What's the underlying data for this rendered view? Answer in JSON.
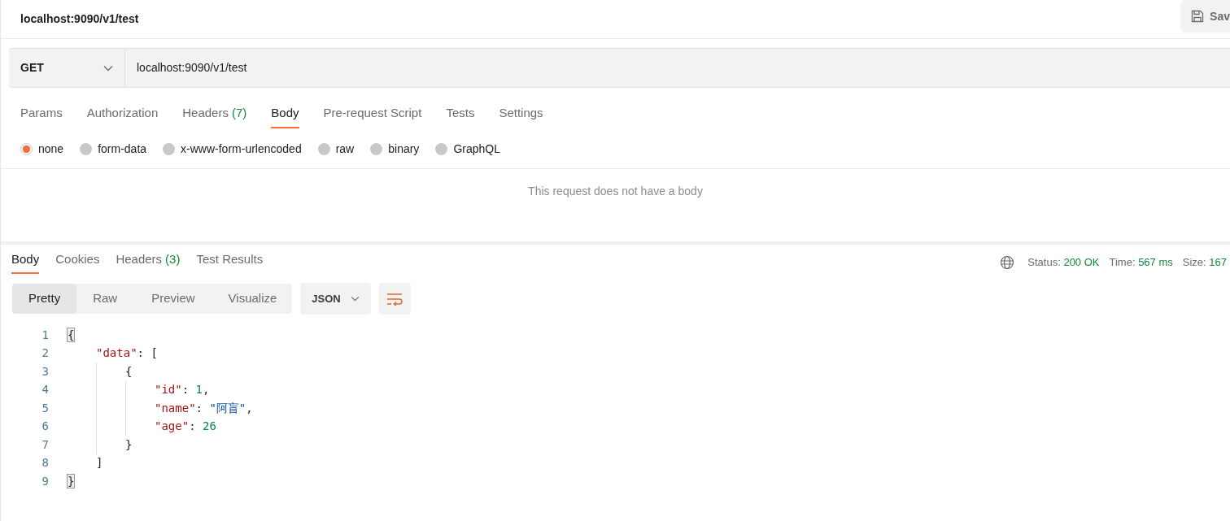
{
  "request_title": "localhost:9090/v1/test",
  "save_button": {
    "label": "Sav"
  },
  "method": "GET",
  "url": "localhost:9090/v1/test",
  "request_tabs": [
    {
      "label": "Params",
      "selected": false
    },
    {
      "label": "Authorization",
      "selected": false
    },
    {
      "label": "Headers",
      "count": "(7)",
      "selected": false
    },
    {
      "label": "Body",
      "selected": true
    },
    {
      "label": "Pre-request Script",
      "selected": false
    },
    {
      "label": "Tests",
      "selected": false
    },
    {
      "label": "Settings",
      "selected": false
    }
  ],
  "body_types": [
    {
      "label": "none",
      "selected": true
    },
    {
      "label": "form-data",
      "selected": false
    },
    {
      "label": "x-www-form-urlencoded",
      "selected": false
    },
    {
      "label": "raw",
      "selected": false
    },
    {
      "label": "binary",
      "selected": false
    },
    {
      "label": "GraphQL",
      "selected": false
    }
  ],
  "empty_body_message": "This request does not have a body",
  "response_tabs": [
    {
      "label": "Body",
      "selected": true
    },
    {
      "label": "Cookies",
      "selected": false
    },
    {
      "label": "Headers",
      "count": "(3)",
      "selected": false
    },
    {
      "label": "Test Results",
      "selected": false
    }
  ],
  "response_stats": [
    {
      "label": "Status:",
      "value": "200 OK"
    },
    {
      "label": "Time:",
      "value": "567 ms"
    },
    {
      "label": "Size:",
      "value": "167"
    }
  ],
  "view_modes": [
    {
      "label": "Pretty",
      "selected": true
    },
    {
      "label": "Raw",
      "selected": false
    },
    {
      "label": "Preview",
      "selected": false
    },
    {
      "label": "Visualize",
      "selected": false
    }
  ],
  "format": "JSON",
  "code_lines": [
    {
      "number": "1",
      "tokens": [
        {
          "kind": "punct",
          "text": "{",
          "highlighted": true
        }
      ]
    },
    {
      "number": "2",
      "tokens": [
        {
          "kind": "key",
          "text": "\"data\""
        },
        {
          "kind": "punct",
          "text": ": ["
        }
      ]
    },
    {
      "number": "3",
      "tokens": [
        {
          "kind": "punct",
          "text": "{"
        }
      ]
    },
    {
      "number": "4",
      "tokens": [
        {
          "kind": "key",
          "text": "\"id\""
        },
        {
          "kind": "punct",
          "text": ": "
        },
        {
          "kind": "number",
          "text": "1"
        },
        {
          "kind": "punct",
          "text": ","
        }
      ]
    },
    {
      "number": "5",
      "tokens": [
        {
          "kind": "key",
          "text": "\"name\""
        },
        {
          "kind": "punct",
          "text": ": "
        },
        {
          "kind": "string",
          "text": "\"阿盲\""
        },
        {
          "kind": "punct",
          "text": ","
        }
      ]
    },
    {
      "number": "6",
      "tokens": [
        {
          "kind": "key",
          "text": "\"age\""
        },
        {
          "kind": "punct",
          "text": ": "
        },
        {
          "kind": "number",
          "text": "26"
        }
      ]
    },
    {
      "number": "7",
      "tokens": [
        {
          "kind": "punct",
          "text": "}"
        }
      ]
    },
    {
      "number": "8",
      "tokens": [
        {
          "kind": "punct",
          "text": "]"
        }
      ]
    },
    {
      "number": "9",
      "tokens": [
        {
          "kind": "punct",
          "text": "}",
          "highlighted": true
        }
      ]
    }
  ]
}
